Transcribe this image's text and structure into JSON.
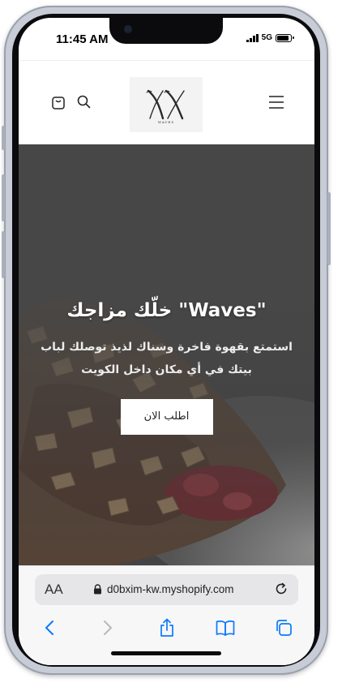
{
  "device": {
    "status_bar": {
      "time": "11:45 AM",
      "network": "5G",
      "battery_level": 0.9
    }
  },
  "shop_header": {
    "logo_label": "WAVES",
    "icons": {
      "cart": "bag-icon",
      "search": "search-icon",
      "menu": "hamburger-menu-icon"
    }
  },
  "hero": {
    "title": "\"Waves\" خلّك مزاجك",
    "description": "استمتع بقهوة فاخرة وسناك لذيذ توصلك لباب بيتك في أي مكان داخل الكويت",
    "cta_label": "اطلب الان"
  },
  "browser": {
    "text_size_label": "AA",
    "url": "d0bxim-kw.myshopify.com",
    "icons": {
      "lock": "lock-icon",
      "reload": "reload-icon",
      "back": "back-arrow-icon",
      "forward": "forward-arrow-icon",
      "share": "share-icon",
      "bookmarks": "bookmarks-book-icon",
      "tabs": "tabs-icon"
    }
  },
  "colors": {
    "hero_overlay": "#4a4a4a",
    "link_blue": "#0a7aff",
    "cta_background": "#ffffff"
  }
}
